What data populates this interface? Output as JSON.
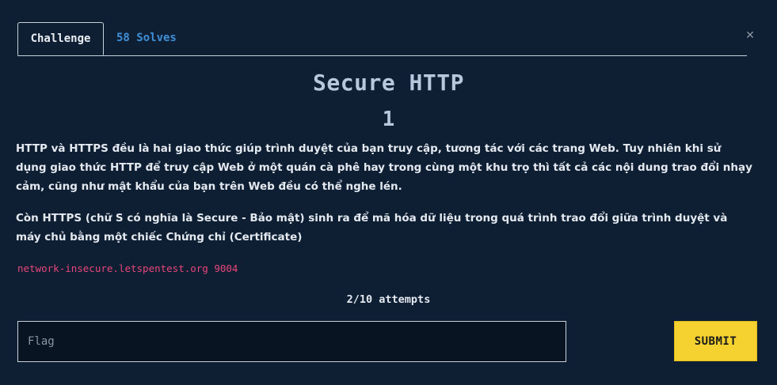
{
  "tabs": {
    "challenge_label": "Challenge",
    "solves_label": "58 Solves"
  },
  "close_icon": "close-icon",
  "challenge": {
    "title": "Secure HTTP",
    "value": "1",
    "description": [
      "HTTP và HTTPS đều là hai giao thức giúp trình duyệt của bạn truy cập, tương tác với các trang Web. Tuy nhiên khi sử dụng giao thức HTTP để truy cập Web ở một quán cà phê hay trong cùng một khu trọ thì tất cả các nội dung trao đổi nhạy cảm, cũng như mật khẩu của bạn trên Web đều có thể nghe lén.",
      "Còn HTTPS (chữ S có nghĩa là Secure - Bảo mật) sinh ra để mã hóa dữ liệu trong quá trình trao đổi giữa trình duyệt và máy chủ bằng một chiếc Chứng chỉ (Certificate)"
    ],
    "connection_info": "network-insecure.letspentest.org 9004",
    "attempts": "2/10 attempts"
  },
  "form": {
    "flag_placeholder": "Flag",
    "flag_value": "",
    "submit_label": "SUBMIT"
  },
  "colors": {
    "background": "#0e1e33",
    "accent_link": "#3f8fd6",
    "connection_text": "#e6477a",
    "submit_button": "#f5d22f"
  }
}
